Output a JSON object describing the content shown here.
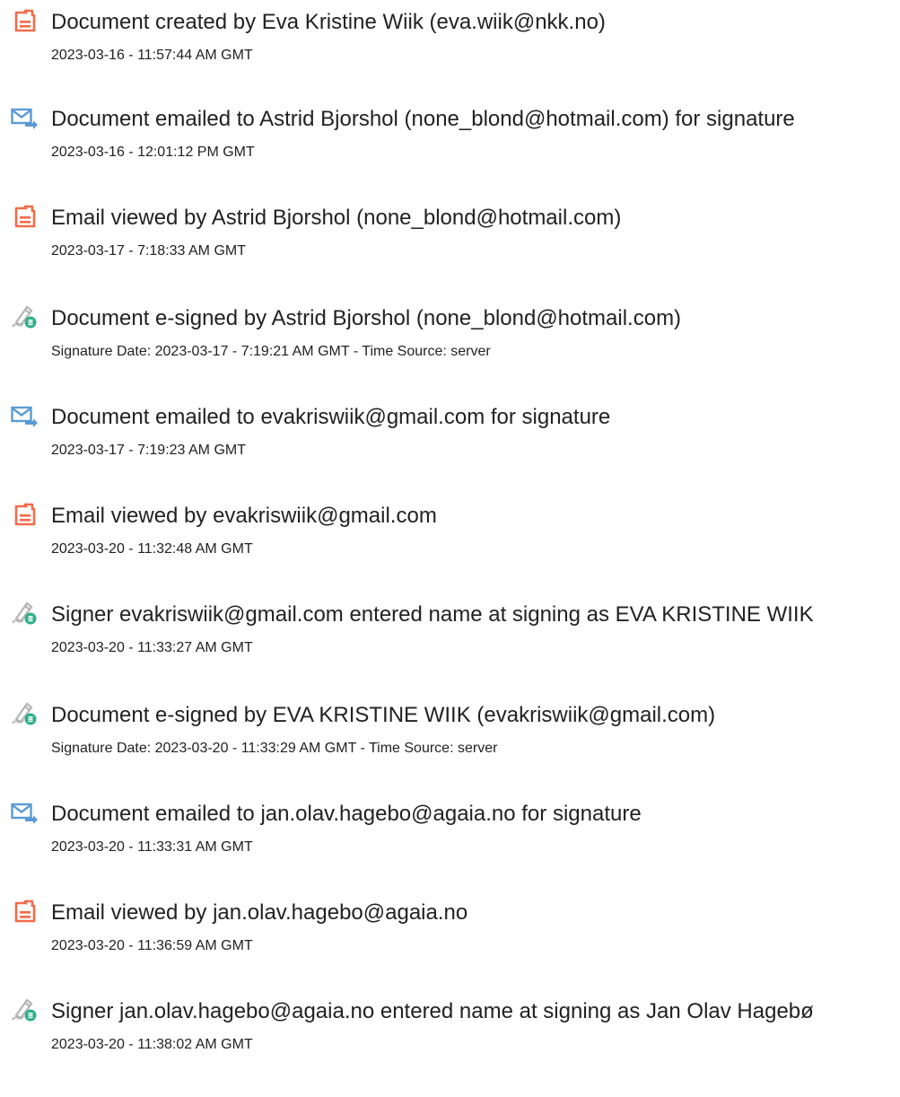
{
  "events": [
    {
      "icon": "document-created-icon",
      "title": "Document created by Eva Kristine Wiik (eva.wiik@nkk.no)",
      "detail": "2023-03-16 - 11:57:44 AM GMT"
    },
    {
      "icon": "email-sent-icon",
      "title": "Document emailed to Astrid Bjorshol (none_blond@hotmail.com) for signature",
      "detail": "2023-03-16 - 12:01:12 PM GMT"
    },
    {
      "icon": "document-created-icon",
      "title": "Email viewed by Astrid Bjorshol (none_blond@hotmail.com)",
      "detail": "2023-03-17 - 7:18:33 AM GMT"
    },
    {
      "icon": "e-sign-icon",
      "title": "Document e-signed by Astrid Bjorshol (none_blond@hotmail.com)",
      "detail": "Signature Date: 2023-03-17 - 7:19:21 AM GMT - Time Source: server"
    },
    {
      "icon": "email-sent-icon",
      "title": "Document emailed to evakriswiik@gmail.com for signature",
      "detail": "2023-03-17 - 7:19:23 AM GMT"
    },
    {
      "icon": "document-created-icon",
      "title": "Email viewed by evakriswiik@gmail.com",
      "detail": "2023-03-20 - 11:32:48 AM GMT"
    },
    {
      "icon": "e-sign-icon",
      "title": "Signer evakriswiik@gmail.com entered name at signing as EVA KRISTINE WIIK",
      "detail": "2023-03-20 - 11:33:27 AM GMT"
    },
    {
      "icon": "e-sign-icon",
      "title": "Document e-signed by EVA KRISTINE WIIK (evakriswiik@gmail.com)",
      "detail": "Signature Date: 2023-03-20 - 11:33:29 AM GMT - Time Source: server"
    },
    {
      "icon": "email-sent-icon",
      "title": "Document emailed to jan.olav.hagebo@agaia.no for signature",
      "detail": "2023-03-20 - 11:33:31 AM GMT"
    },
    {
      "icon": "document-created-icon",
      "title": "Email viewed by jan.olav.hagebo@agaia.no",
      "detail": "2023-03-20 - 11:36:59 AM GMT"
    },
    {
      "icon": "e-sign-icon",
      "title": "Signer jan.olav.hagebo@agaia.no entered name at signing as Jan Olav Hagebø",
      "detail": "2023-03-20 - 11:38:02 AM GMT"
    }
  ],
  "colors": {
    "document_icon": "#F26B4B",
    "email_icon": "#5B9BD5",
    "sign_pen": "#B5B5B5",
    "sign_badge": "#2EAF8A"
  }
}
